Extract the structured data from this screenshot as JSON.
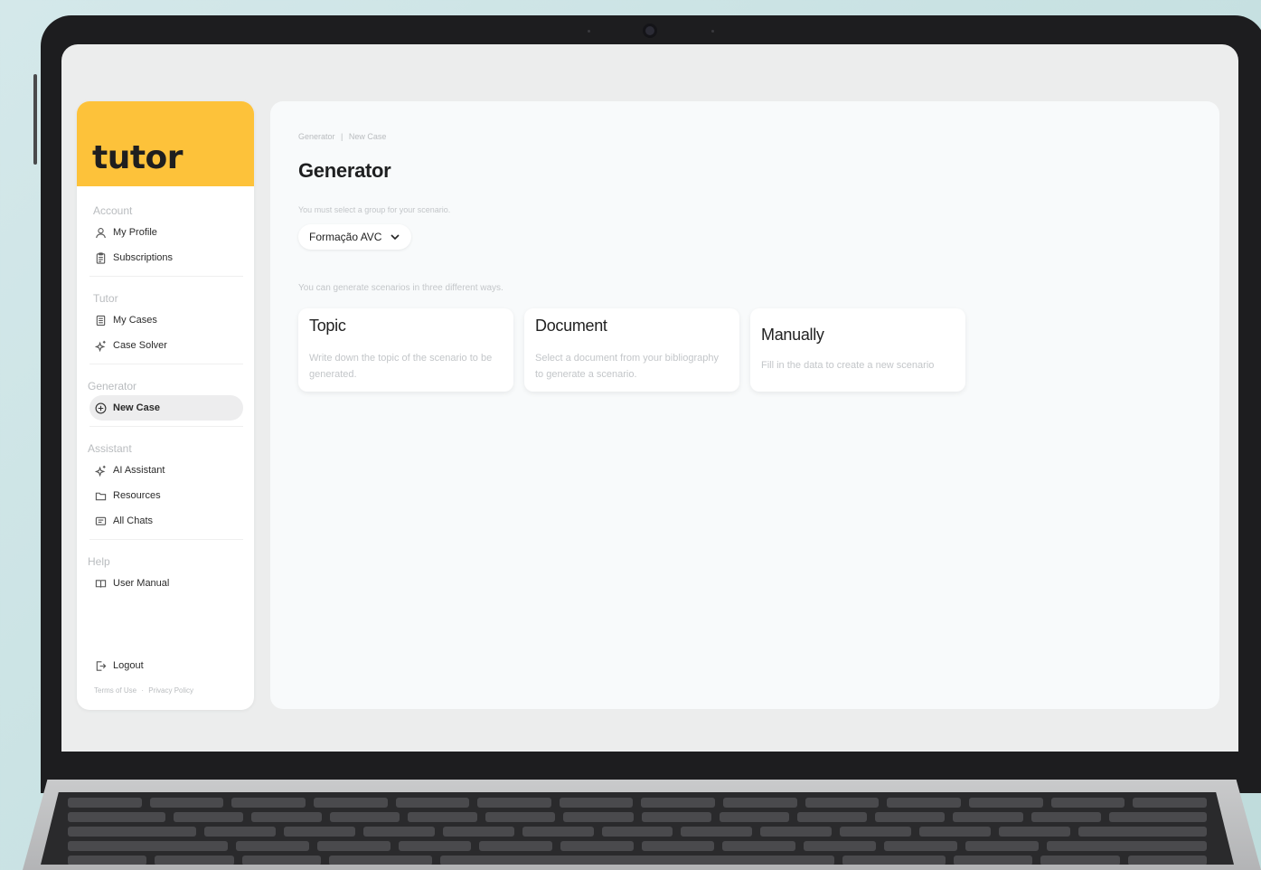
{
  "app": {
    "brand": "tutor"
  },
  "sidebar": {
    "sections": [
      {
        "title": "Account",
        "items": [
          {
            "label": "My Profile",
            "icon": "user-icon"
          },
          {
            "label": "Subscriptions",
            "icon": "clipboard-icon"
          }
        ]
      },
      {
        "title": "Tutor",
        "items": [
          {
            "label": "My Cases",
            "icon": "document-icon"
          },
          {
            "label": "Case Solver",
            "icon": "sparkle-icon"
          }
        ]
      },
      {
        "title": "Generator",
        "items": [
          {
            "label": "New Case",
            "icon": "plus-circle-icon",
            "active": true
          }
        ]
      },
      {
        "title": "Assistant",
        "items": [
          {
            "label": "AI Assistant",
            "icon": "sparkle-icon"
          },
          {
            "label": "Resources",
            "icon": "folder-icon"
          },
          {
            "label": "All Chats",
            "icon": "chat-list-icon"
          }
        ]
      },
      {
        "title": "Help",
        "items": [
          {
            "label": "User Manual",
            "icon": "book-icon"
          }
        ]
      }
    ],
    "logout_label": "Logout",
    "footer": {
      "terms": "Terms of Use",
      "separator": "·",
      "privacy": "Privacy Policy"
    }
  },
  "main": {
    "breadcrumb": {
      "first": "Generator",
      "separator": "|",
      "current": "New Case"
    },
    "title": "Generator",
    "group_hint": "You must select a group for your scenario.",
    "group_select": {
      "value": "Formação AVC"
    },
    "ways_hint": "You can generate scenarios in three different ways.",
    "cards": [
      {
        "title": "Topic",
        "description": "Write down the topic of the scenario to be generated."
      },
      {
        "title": "Document",
        "description": "Select a document from your bibliography to generate a scenario."
      },
      {
        "title": "Manually",
        "description": "Fill in the data to create a new scenario"
      }
    ]
  },
  "colors": {
    "brand_yellow": "#fdc23a",
    "active_item_bg": "#ededee"
  }
}
